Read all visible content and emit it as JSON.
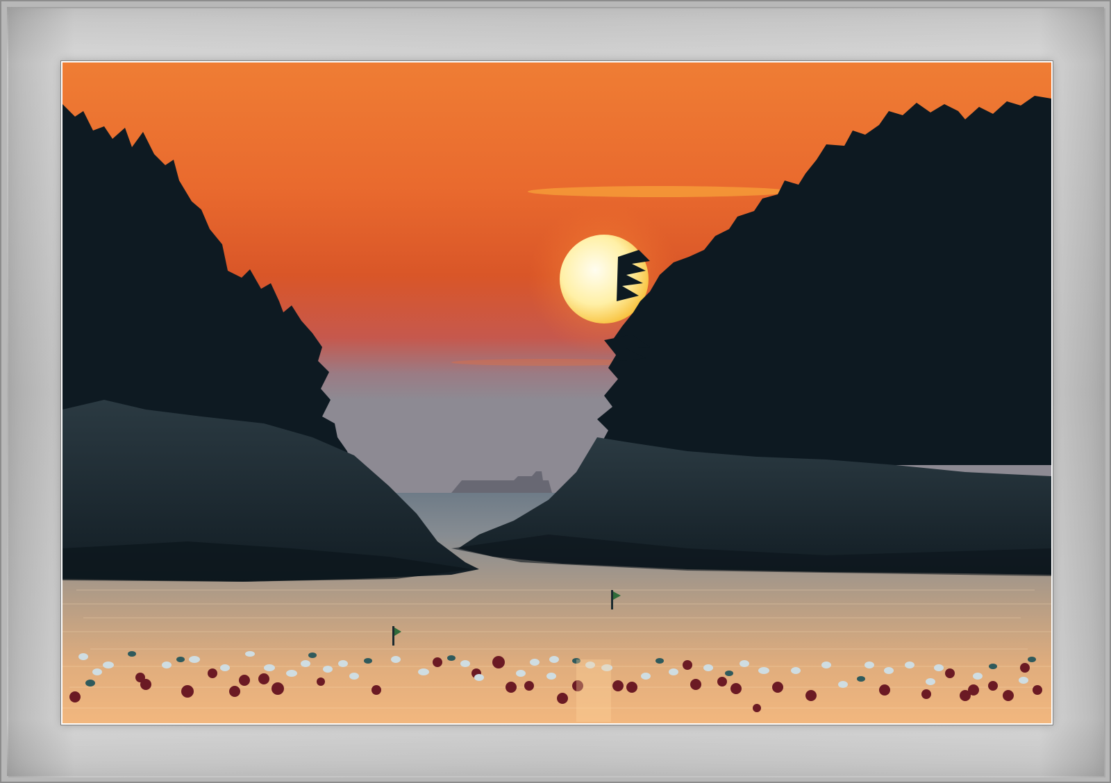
{
  "scene": {
    "subject": "sunset-over-sea-between-islands",
    "palette": {
      "sky_top": "#e97a33",
      "sky_mid": "#e45f2c",
      "sky_haze": "#a77d82",
      "sun_core": "#fffbe0",
      "sun_edge": "#f7bf2c",
      "silhouette": "#0d1a22",
      "water_far": "#7f8a95",
      "water_near": "#f0b27b",
      "buoy_dark": "#6b1a24",
      "buoy_light": "#d9e2e5",
      "frame": "#cfcfcf"
    }
  }
}
